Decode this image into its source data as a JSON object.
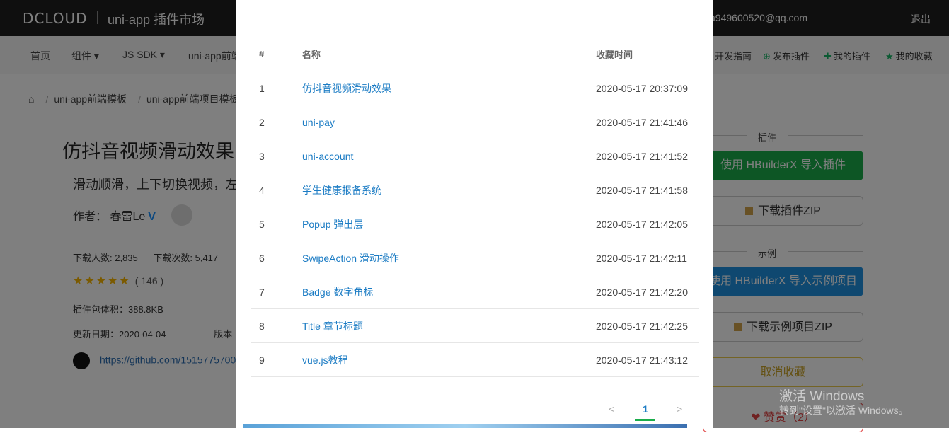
{
  "header": {
    "logo": "DCLOUD",
    "app_title": "uni-app 插件市场",
    "email": "a949600520@qq.com",
    "logout": "退出"
  },
  "nav": {
    "items": [
      "首页",
      "组件 ▾",
      "JS SDK ▾",
      "uni-app前端"
    ],
    "right": [
      "开发指南",
      "发布插件",
      "我的插件",
      "我的收藏"
    ]
  },
  "breadcrumb": [
    "uni-app前端模板",
    "uni-app前端项目模板"
  ],
  "plugin": {
    "title": "仿抖音视频滑动效果",
    "desc": "滑动顺滑，上下切换视频，左",
    "author_label": "作者：",
    "author_name": "春雷Le",
    "author_badge": "V",
    "downloads_people": "下载人数: 2,835",
    "downloads_times": "下载次数: 5,417",
    "rating_count": "( 146 )",
    "package_size": "插件包体积：388.8KB",
    "updated": "更新日期：2020-04-04",
    "version_label": "版本",
    "github_url": "https://github.com/1515775700"
  },
  "sidebar": {
    "plugin_head": "插件",
    "import_plugin": "使用 HBuilderX 导入插件",
    "download_zip": "下载插件ZIP",
    "example_head": "示例",
    "import_example": "使用 HBuilderX 导入示例项目",
    "download_example": "下载示例项目ZIP",
    "unfavorite": "取消收藏",
    "like": "赞赏（2）"
  },
  "watermark": {
    "line1": "激活 Windows",
    "line2": "转到\"设置\"以激活 Windows。"
  },
  "modal": {
    "columns": [
      "#",
      "名称",
      "收藏时间"
    ],
    "rows": [
      {
        "num": "1",
        "name": "仿抖音视频滑动效果",
        "time": "2020-05-17 20:37:09"
      },
      {
        "num": "2",
        "name": "uni-pay",
        "time": "2020-05-17 21:41:46"
      },
      {
        "num": "3",
        "name": "uni-account",
        "time": "2020-05-17 21:41:52"
      },
      {
        "num": "4",
        "name": "学生健康报备系统",
        "time": "2020-05-17 21:41:58"
      },
      {
        "num": "5",
        "name": "Popup 弹出层",
        "time": "2020-05-17 21:42:05"
      },
      {
        "num": "6",
        "name": "SwipeAction 滑动操作",
        "time": "2020-05-17 21:42:11"
      },
      {
        "num": "7",
        "name": "Badge 数字角标",
        "time": "2020-05-17 21:42:20"
      },
      {
        "num": "8",
        "name": "Title 章节标题",
        "time": "2020-05-17 21:42:25"
      },
      {
        "num": "9",
        "name": "vue.js教程",
        "time": "2020-05-17 21:43:12"
      }
    ],
    "pager": {
      "prev": "<",
      "current": "1",
      "next": ">"
    }
  }
}
